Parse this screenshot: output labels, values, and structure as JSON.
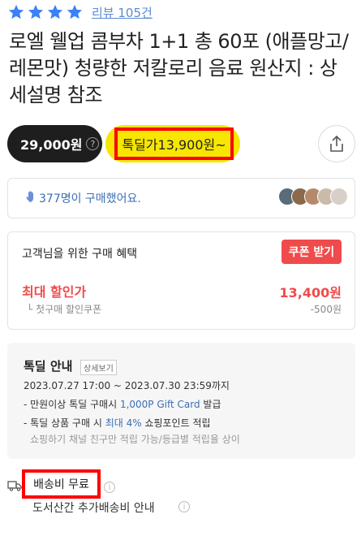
{
  "rating": {
    "stars": 4,
    "star_color": "#3b82f6",
    "review_label": "리뷰 105건"
  },
  "product": {
    "title": "로엘 웰업 콤부차 1+1 총 60포 (애플망고/레몬맛) 청량한 저칼로리 음료 원산지 : 상세설명 참조"
  },
  "price": {
    "original": "29,000원",
    "info_icon": "question-icon",
    "deal_label": "톡딜가",
    "deal_price": "13,900원~",
    "deal_color": "#f7e600"
  },
  "share": {
    "icon": "share-icon"
  },
  "buyers": {
    "text": "377명이 구매했어요."
  },
  "benefit": {
    "title": "고객님을 위한 구매 혜택",
    "coupon_button": "쿠폰 받기",
    "max_label": "최대 할인가",
    "max_value": "13,400원",
    "first_label": "첫구매 할인쿠폰",
    "first_value": "-500원",
    "accent_color": "#f04b4b"
  },
  "deal_info": {
    "title": "톡딜 안내",
    "detail_tag": "상세보기",
    "period": "2023.07.27 17:00 ~ 2023.07.30 23:59까지",
    "line1_prefix": "- 만원이상 톡딜 구매시 ",
    "line1_highlight": "1,000P Gift Card",
    "line1_suffix": " 발급",
    "line2_prefix": "- 톡딜 상품 구매 시 ",
    "line2_highlight": "최대 4%",
    "line2_suffix": " 쇼핑포인트 적립",
    "note": "쇼핑하기 채널 친구만 적립 가능/등급별 적립율 상이"
  },
  "shipping": {
    "label": "배송비 무료",
    "extra": "도서산간 추가배송비 안내"
  }
}
